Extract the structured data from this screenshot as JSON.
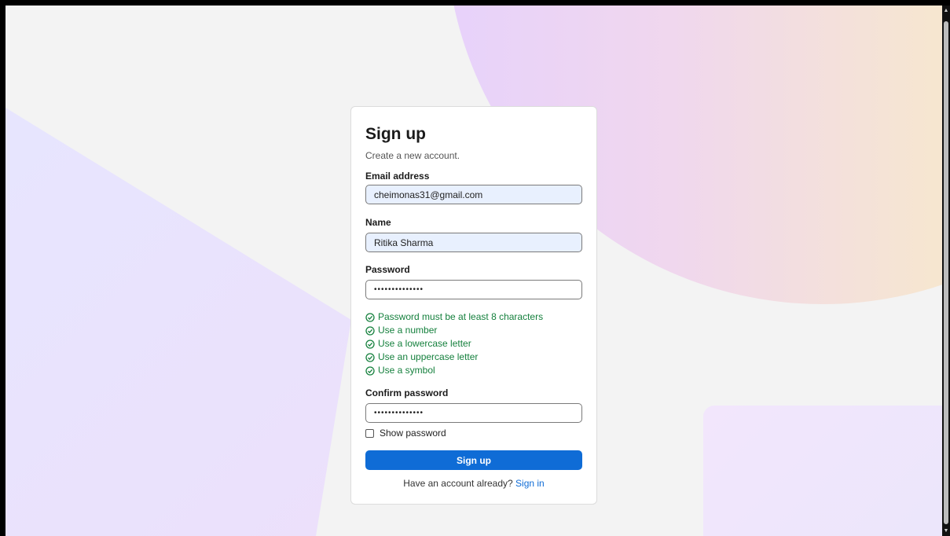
{
  "form": {
    "title": "Sign up",
    "subtitle": "Create a new account.",
    "email": {
      "label": "Email address",
      "value": "cheimonas31@gmail.com"
    },
    "name": {
      "label": "Name",
      "value": "Ritika Sharma"
    },
    "password": {
      "label": "Password",
      "value": "••••••••••••••"
    },
    "rules": [
      "Password must be at least 8 characters",
      "Use a number",
      "Use a lowercase letter",
      "Use an uppercase letter",
      "Use a symbol"
    ],
    "confirm": {
      "label": "Confirm password",
      "value": "••••••••••••••"
    },
    "show_password": "Show password",
    "submit": "Sign up",
    "footer_text": "Have an account already?",
    "signin_link": "Sign in"
  },
  "colors": {
    "accent": "#0f6cd6",
    "success": "#15803d",
    "autofill_bg": "#e8f0fe"
  },
  "icons": {
    "rule_ok": "check-circle-icon",
    "scroll_up": "arrow-up-icon",
    "scroll_down": "arrow-down-icon"
  }
}
